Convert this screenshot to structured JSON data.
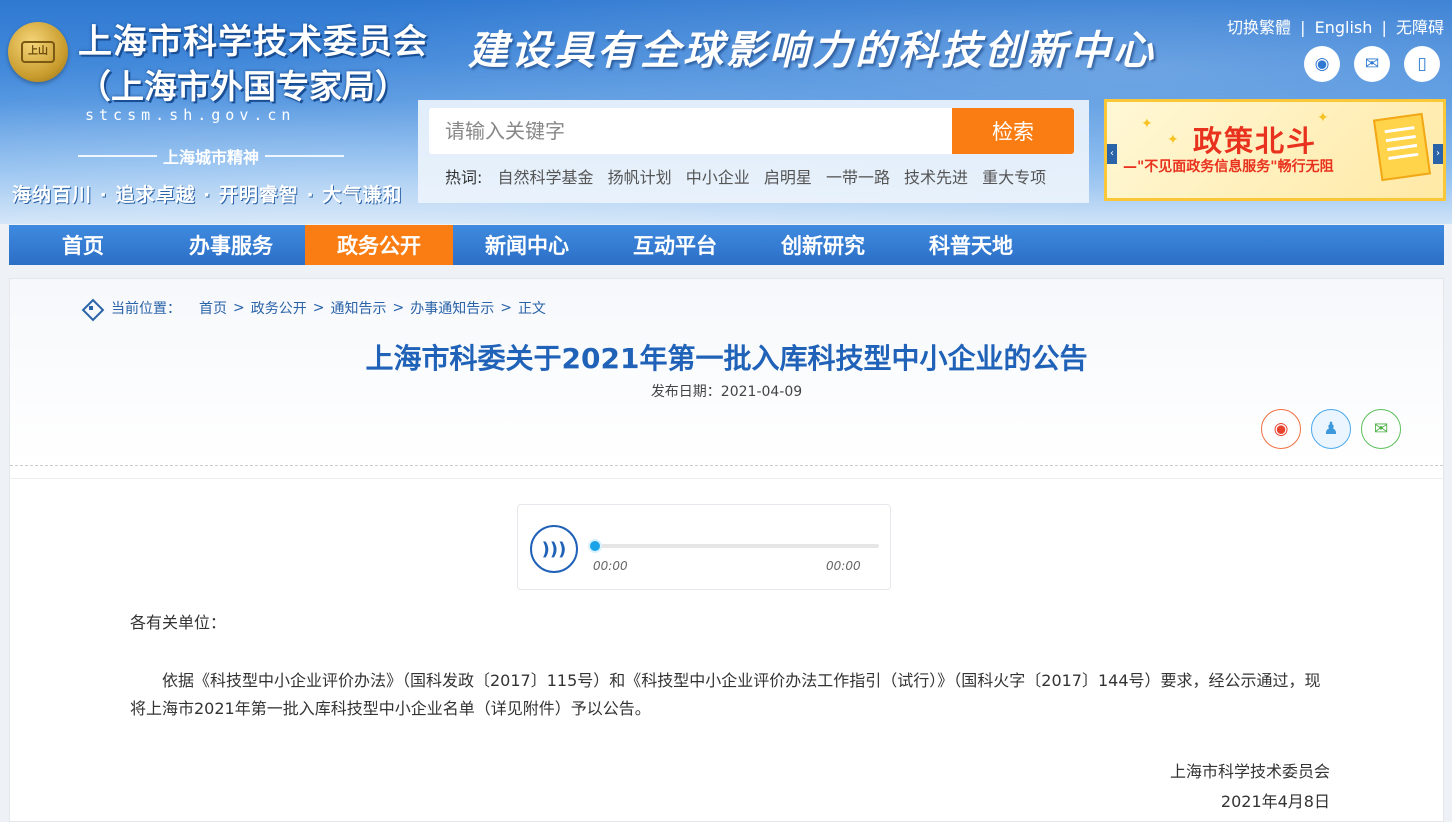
{
  "header": {
    "emblem_text": "上山",
    "org_title": "上海市科学技术委员会",
    "org_subtitle": "（上海市外国专家局）",
    "domain": "stcsm.sh.gov.cn",
    "spirit_title": "上海城市精神",
    "spirit_text": "海纳百川 · 追求卓越 · 开明睿智 · 大气谦和",
    "slogan": "建设具有全球影响力的科技创新中心",
    "top_links": [
      "切换繁體",
      "English",
      "无障碍"
    ],
    "social": [
      {
        "icon": "weibo-icon",
        "glyph": "◉"
      },
      {
        "icon": "wechat-icon",
        "glyph": "✉"
      },
      {
        "icon": "mobile-icon",
        "glyph": "▯"
      }
    ]
  },
  "search": {
    "placeholder": "请输入关键字",
    "button_label": "检索",
    "hot_label": "热词:",
    "hot_words": [
      "自然科学基金",
      "扬帆计划",
      "中小企业",
      "启明星",
      "一带一路",
      "技术先进",
      "重大专项"
    ]
  },
  "promo": {
    "title": "政策北斗",
    "subtitle": "—\"不见面政务信息服务\"畅行无阻"
  },
  "nav": {
    "items": [
      "首页",
      "办事服务",
      "政务公开",
      "新闻中心",
      "互动平台",
      "创新研究",
      "科普天地"
    ],
    "active_index": 2
  },
  "breadcrumb": {
    "label": "当前位置：",
    "items": [
      "首页",
      "政务公开",
      "通知告示",
      "办事通知告示",
      "正文"
    ]
  },
  "article": {
    "title": "上海市科委关于2021年第一批入库科技型中小企业的公告",
    "publish_date": "发布日期：2021-04-09",
    "salutation": "各有关单位：",
    "paragraph": "依据《科技型中小企业评价办法》（国科发政〔2017〕115号）和《科技型中小企业评价办法工作指引（试行）》（国科火字〔2017〕144号）要求，经公示通过，现将上海市2021年第一批入库科技型中小企业名单（详见附件）予以公告。",
    "signature_org": "上海市科学技术委员会",
    "signature_date": "2021年4月8日"
  },
  "audio": {
    "time_current": "00:00",
    "time_total": "00:00",
    "progress": 0
  },
  "colors": {
    "nav_bg": "#2b6fc5",
    "accent_orange": "#f97d12",
    "title_blue": "#2062b8"
  }
}
